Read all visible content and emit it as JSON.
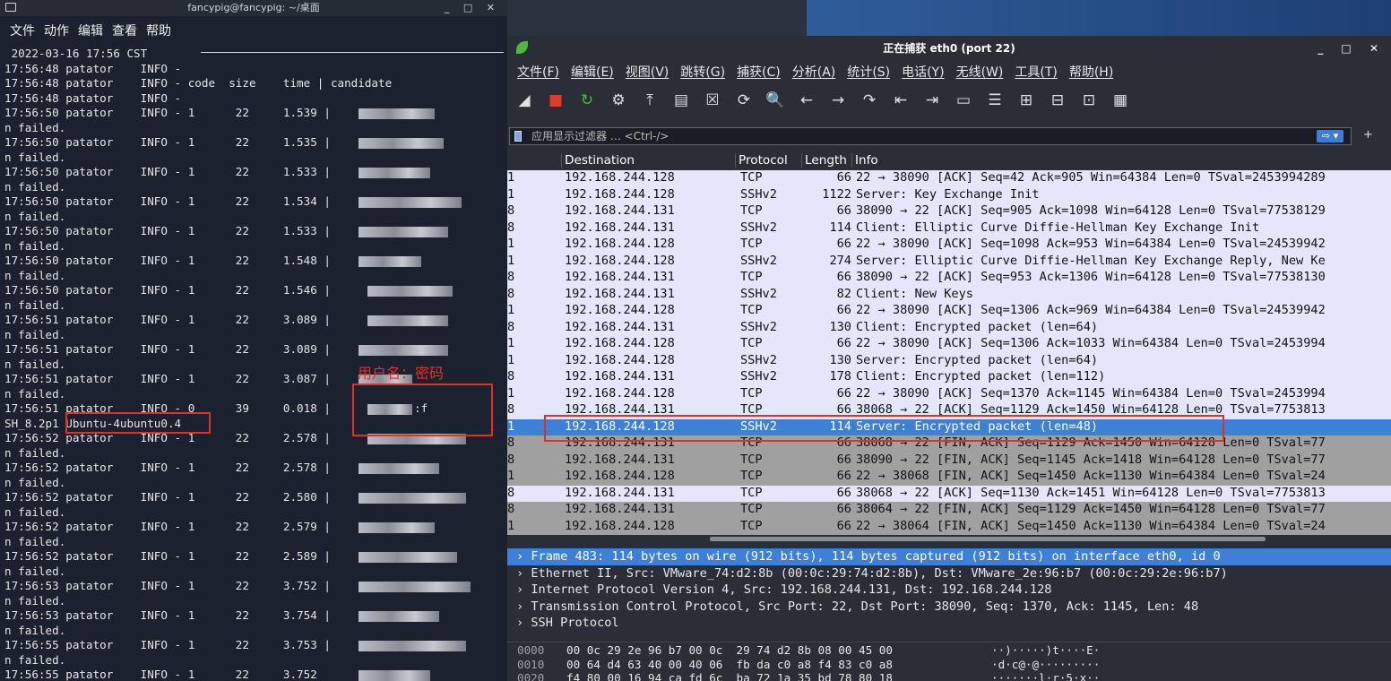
{
  "desktop": {
    "accent": "#2f5d9a"
  },
  "terminal": {
    "title": "fancypig@fancypig: ~/桌面",
    "window_controls": "_ □ ✕",
    "menu": [
      "文件",
      "动作",
      "编辑",
      "查看",
      "帮助"
    ],
    "lines": [
      {
        "t": " 2022-03-16 17:56 CST"
      },
      {
        "t": "17:56:48 patator    INFO -"
      },
      {
        "t": "17:56:48 patator    INFO - code  size    time | candidate"
      },
      {
        "t": "17:56:48 patator    INFO -"
      },
      {
        "t": "17:56:50 patator    INFO - 1      22     1.539 |",
        "b": [
          395,
          85
        ]
      },
      {
        "t": "n failed."
      },
      {
        "t": "17:56:50 patator    INFO - 1      22     1.535 |",
        "b": [
          395,
          95
        ]
      },
      {
        "t": "n failed."
      },
      {
        "t": "17:56:50 patator    INFO - 1      22     1.533 |",
        "b": [
          395,
          80
        ]
      },
      {
        "t": "n failed."
      },
      {
        "t": "17:56:50 patator    INFO - 1      22     1.534 |",
        "b": [
          395,
          115
        ]
      },
      {
        "t": "n failed."
      },
      {
        "t": "17:56:50 patator    INFO - 1      22     1.533 |",
        "b": [
          395,
          100
        ]
      },
      {
        "t": "n failed."
      },
      {
        "t": "17:56:50 patator    INFO - 1      22     1.548 |",
        "b": [
          395,
          70
        ]
      },
      {
        "t": "n failed."
      },
      {
        "t": "17:56:50 patator    INFO - 1      22     1.546 |",
        "b": [
          405,
          95
        ]
      },
      {
        "t": "n failed."
      },
      {
        "t": "17:56:51 patator    INFO - 1      22     3.089 |",
        "b": [
          405,
          90
        ]
      },
      {
        "t": "n failed."
      },
      {
        "t": "17:56:51 patator    INFO - 1      22     3.089 |",
        "b": [
          395,
          100
        ]
      },
      {
        "t": "n failed."
      },
      {
        "t": "17:56:51 patator    INFO - 1      22     3.087 |",
        "b": [
          395,
          60
        ]
      },
      {
        "t": "n failed."
      },
      {
        "t": "17:56:51 patator    INFO - 0      39     0.018 |",
        "b": [
          405,
          50
        ],
        "x": ":f"
      },
      {
        "t": "SH_8.2p1 Ubuntu-4ubuntu0.4"
      },
      {
        "t": "17:56:52 patator    INFO - 1      22     2.578 |",
        "b": [
          405,
          110
        ]
      },
      {
        "t": "n failed."
      },
      {
        "t": "17:56:52 patator    INFO - 1      22     2.578 |",
        "b": [
          395,
          90
        ]
      },
      {
        "t": "n failed."
      },
      {
        "t": "17:56:52 patator    INFO - 1      22     2.580 |",
        "b": [
          395,
          120
        ]
      },
      {
        "t": "n failed."
      },
      {
        "t": "17:56:52 patator    INFO - 1      22     2.579 |",
        "b": [
          395,
          85
        ]
      },
      {
        "t": "n failed."
      },
      {
        "t": "17:56:52 patator    INFO - 1      22     2.589 |",
        "b": [
          395,
          110
        ]
      },
      {
        "t": "n failed."
      },
      {
        "t": "17:56:53 patator    INFO - 1      22     3.752 |",
        "b": [
          395,
          125
        ]
      },
      {
        "t": "n failed."
      },
      {
        "t": "17:56:53 patator    INFO - 1      22     3.754 |",
        "b": [
          395,
          90
        ]
      },
      {
        "t": "n failed."
      },
      {
        "t": "17:56:55 patator    INFO - 1      22     3.753 |",
        "b": [
          395,
          120
        ]
      },
      {
        "t": "n failed."
      },
      {
        "t": "17:56:55 patator    INFO - 1      22     3.752",
        "b": [
          395,
          80
        ]
      }
    ],
    "annotation": "用户名：密码"
  },
  "wireshark": {
    "title": "正在捕获 eth0 (port 22)",
    "window_controls": "_ □ ✕",
    "menu": [
      "文件(F)",
      "编辑(E)",
      "视图(V)",
      "跳转(G)",
      "捕获(C)",
      "分析(A)",
      "统计(S)",
      "电话(Y)",
      "无线(W)",
      "工具(T)",
      "帮助(H)"
    ],
    "toolbar": [
      {
        "icon": "shark-fin-start-icon",
        "g": "◢"
      },
      {
        "icon": "stop-capture-icon",
        "g": "■"
      },
      {
        "icon": "restart-capture-icon",
        "g": "↻"
      },
      {
        "icon": "capture-options-icon",
        "g": "⚙"
      },
      {
        "icon": "open-file-icon",
        "g": "⤒"
      },
      {
        "icon": "save-file-icon",
        "g": "▤"
      },
      {
        "icon": "close-file-icon",
        "g": "☒"
      },
      {
        "icon": "reload-icon",
        "g": "⟳"
      },
      {
        "icon": "find-packet-icon",
        "g": "🔍"
      },
      {
        "icon": "go-back-icon",
        "g": "←"
      },
      {
        "icon": "go-forward-icon",
        "g": "→"
      },
      {
        "icon": "go-to-packet-icon",
        "g": "↷"
      },
      {
        "icon": "first-packet-icon",
        "g": "⇤"
      },
      {
        "icon": "last-packet-icon",
        "g": "⇥"
      },
      {
        "icon": "autoscroll-icon",
        "g": "▭"
      },
      {
        "icon": "colorize-icon",
        "g": "☰"
      },
      {
        "icon": "zoom-in-icon",
        "g": "⊞"
      },
      {
        "icon": "zoom-out-icon",
        "g": "⊟"
      },
      {
        "icon": "normal-size-icon",
        "g": "⊡"
      },
      {
        "icon": "resize-columns-icon",
        "g": "▦"
      }
    ],
    "filter_placeholder": "应用显示过滤器 … <Ctrl-/>",
    "columns": [
      "Destination",
      "Protocol",
      "Length",
      "Info"
    ],
    "packets": [
      {
        "s": "1",
        "d": "192.168.244.128",
        "p": "TCP",
        "l": "66",
        "i": "22 → 38090 [ACK] Seq=42 Ack=905 Win=64384 Len=0 TSval=2453994289",
        "c": "tcp"
      },
      {
        "s": "1",
        "d": "192.168.244.128",
        "p": "SSHv2",
        "l": "1122",
        "i": "Server: Key Exchange Init",
        "c": "ssh"
      },
      {
        "s": "8",
        "d": "192.168.244.131",
        "p": "TCP",
        "l": "66",
        "i": "38090 → 22 [ACK] Seq=905 Ack=1098 Win=64128 Len=0 TSval=77538129",
        "c": "tcp"
      },
      {
        "s": "8",
        "d": "192.168.244.131",
        "p": "SSHv2",
        "l": "114",
        "i": "Client: Elliptic Curve Diffie-Hellman Key Exchange Init",
        "c": "ssh"
      },
      {
        "s": "1",
        "d": "192.168.244.128",
        "p": "TCP",
        "l": "66",
        "i": "22 → 38090 [ACK] Seq=1098 Ack=953 Win=64384 Len=0 TSval=24539942",
        "c": "tcp"
      },
      {
        "s": "1",
        "d": "192.168.244.128",
        "p": "SSHv2",
        "l": "274",
        "i": "Server: Elliptic Curve Diffie-Hellman Key Exchange Reply, New Ke",
        "c": "ssh"
      },
      {
        "s": "8",
        "d": "192.168.244.131",
        "p": "TCP",
        "l": "66",
        "i": "38090 → 22 [ACK] Seq=953 Ack=1306 Win=64128 Len=0 TSval=77538130",
        "c": "tcp"
      },
      {
        "s": "8",
        "d": "192.168.244.131",
        "p": "SSHv2",
        "l": "82",
        "i": "Client: New Keys",
        "c": "ssh"
      },
      {
        "s": "1",
        "d": "192.168.244.128",
        "p": "TCP",
        "l": "66",
        "i": "22 → 38090 [ACK] Seq=1306 Ack=969 Win=64384 Len=0 TSval=24539942",
        "c": "tcp"
      },
      {
        "s": "8",
        "d": "192.168.244.131",
        "p": "SSHv2",
        "l": "130",
        "i": "Client: Encrypted packet (len=64)",
        "c": "ssh"
      },
      {
        "s": "1",
        "d": "192.168.244.128",
        "p": "TCP",
        "l": "66",
        "i": "22 → 38090 [ACK] Seq=1306 Ack=1033 Win=64384 Len=0 TSval=2453994",
        "c": "tcp"
      },
      {
        "s": "1",
        "d": "192.168.244.128",
        "p": "SSHv2",
        "l": "130",
        "i": "Server: Encrypted packet (len=64)",
        "c": "ssh"
      },
      {
        "s": "8",
        "d": "192.168.244.131",
        "p": "SSHv2",
        "l": "178",
        "i": "Client: Encrypted packet (len=112)",
        "c": "ssh"
      },
      {
        "s": "1",
        "d": "192.168.244.128",
        "p": "TCP",
        "l": "66",
        "i": "22 → 38090 [ACK] Seq=1370 Ack=1145 Win=64384 Len=0 TSval=2453994",
        "c": "tcp"
      },
      {
        "s": "8",
        "d": "192.168.244.131",
        "p": "TCP",
        "l": "66",
        "i": "38068 → 22 [ACK] Seq=1129 Ack=1450 Win=64128 Len=0 TSval=7753813",
        "c": "tcp"
      },
      {
        "s": "1",
        "d": "192.168.244.128",
        "p": "SSHv2",
        "l": "114",
        "i": "Server: Encrypted packet (len=48)",
        "c": "sel"
      },
      {
        "s": "8",
        "d": "192.168.244.131",
        "p": "TCP",
        "l": "66",
        "i": "38068 → 22 [FIN, ACK] Seq=1129 Ack=1450 Win=64128 Len=0 TSval=77",
        "c": "fin"
      },
      {
        "s": "8",
        "d": "192.168.244.131",
        "p": "TCP",
        "l": "66",
        "i": "38090 → 22 [FIN, ACK] Seq=1145 Ack=1418 Win=64128 Len=0 TSval=77",
        "c": "fin"
      },
      {
        "s": "1",
        "d": "192.168.244.128",
        "p": "TCP",
        "l": "66",
        "i": "22 → 38068 [FIN, ACK] Seq=1450 Ack=1130 Win=64384 Len=0 TSval=24",
        "c": "fin"
      },
      {
        "s": "8",
        "d": "192.168.244.131",
        "p": "TCP",
        "l": "66",
        "i": "38068 → 22 [ACK] Seq=1130 Ack=1451 Win=64128 Len=0 TSval=7753813",
        "c": "tcp"
      },
      {
        "s": "8",
        "d": "192.168.244.131",
        "p": "TCP",
        "l": "66",
        "i": "38064 → 22 [FIN, ACK] Seq=1129 Ack=1450 Win=64128 Len=0 TSval=77",
        "c": "fin"
      },
      {
        "s": "1",
        "d": "192.168.244.128",
        "p": "TCP",
        "l": "66",
        "i": "22 → 38064 [FIN, ACK] Seq=1450 Ack=1130 Win=64384 Len=0 TSval=24",
        "c": "fin"
      }
    ],
    "details": [
      "› Frame 483: 114 bytes on wire (912 bits), 114 bytes captured (912 bits) on interface eth0, id 0",
      "› Ethernet II, Src: VMware_74:d2:8b (00:0c:29:74:d2:8b), Dst: VMware_2e:96:b7 (00:0c:29:2e:96:b7)",
      "› Internet Protocol Version 4, Src: 192.168.244.131, Dst: 192.168.244.128",
      "› Transmission Control Protocol, Src Port: 22, Dst Port: 38090, Seq: 1370, Ack: 1145, Len: 48",
      "› SSH Protocol"
    ],
    "hex": [
      {
        "o": "0000",
        "h": "00 0c 29 2e 96 b7 00 0c  29 74 d2 8b 08 00 45 00",
        "a": "··)·····)t····E·"
      },
      {
        "o": "0010",
        "h": "00 64 d4 63 40 00 40 06  fb da c0 a8 f4 83 c0 a8",
        "a": "·d·c@·@·········"
      },
      {
        "o": "0020",
        "h": "f4 80 00 16 94 ca fd 6c  ba 72 1a 35 bd 78 80 18",
        "a": "·······l·r·5·x··"
      }
    ]
  }
}
